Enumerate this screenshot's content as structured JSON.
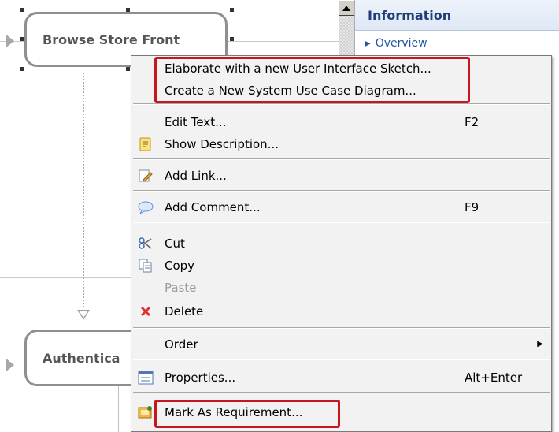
{
  "diagram": {
    "nodes": [
      {
        "label": "Browse Store Front"
      },
      {
        "label": "Authentica"
      }
    ]
  },
  "info_panel": {
    "title": "Information",
    "links": [
      {
        "label": "Overview",
        "icon": "triangle-right-icon"
      }
    ]
  },
  "context_menu": {
    "items": [
      {
        "label": "Elaborate with a new User Interface Sketch...",
        "icon": null,
        "shortcut": "",
        "enabled": true
      },
      {
        "label": "Create a New System Use Case Diagram...",
        "icon": null,
        "shortcut": "",
        "enabled": true
      },
      {
        "label": "Edit Text...",
        "icon": null,
        "shortcut": "F2",
        "enabled": true
      },
      {
        "label": "Show Description...",
        "icon": "note-icon",
        "shortcut": "",
        "enabled": true
      },
      {
        "label": "Add Link...",
        "icon": "link-icon",
        "shortcut": "",
        "enabled": true
      },
      {
        "label": "Add Comment...",
        "icon": "comment-icon",
        "shortcut": "F9",
        "enabled": true
      },
      {
        "label": "Cut",
        "icon": "scissors-icon",
        "shortcut": "",
        "enabled": true
      },
      {
        "label": "Copy",
        "icon": "copy-icon",
        "shortcut": "",
        "enabled": true
      },
      {
        "label": "Paste",
        "icon": null,
        "shortcut": "",
        "enabled": false
      },
      {
        "label": "Delete",
        "icon": "delete-x-icon",
        "shortcut": "",
        "enabled": true
      },
      {
        "label": "Order",
        "icon": null,
        "shortcut": "",
        "enabled": true,
        "submenu": true
      },
      {
        "label": "Properties...",
        "icon": "properties-icon",
        "shortcut": "Alt+Enter",
        "enabled": true
      },
      {
        "label": "Mark As Requirement...",
        "icon": "requirement-icon",
        "shortcut": "",
        "enabled": true
      }
    ]
  },
  "colors": {
    "highlight_box": "#c8161e",
    "panel_title": "#1f3f78",
    "link": "#2356a8",
    "menu_bg": "#f2f2f2"
  }
}
